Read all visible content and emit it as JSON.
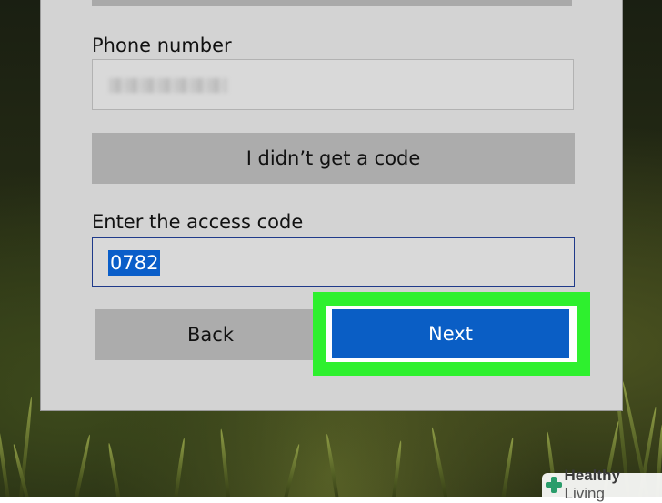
{
  "form": {
    "phone_label": "Phone number",
    "phone_value_hidden": "blurred",
    "no_code_button": "I didn’t get a code",
    "access_code_label": "Enter the access code",
    "access_code_value": "0782",
    "back_button": "Back",
    "next_button": "Next"
  },
  "watermark": {
    "brand_bold": "Healthy",
    "brand_light": " Living"
  },
  "colors": {
    "dialog_bg": "#d3d3d3",
    "primary_button": "#0a5ec5",
    "highlight": "#2ef02e",
    "secondary_button": "#acacac"
  }
}
